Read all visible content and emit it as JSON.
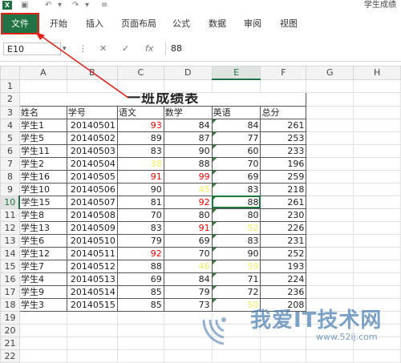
{
  "titlebar": {
    "app_title": "学生成绩",
    "logo": "X",
    "save_icon": "floppy-icon",
    "undo_icon": "↶",
    "redo_icon": "↷"
  },
  "ribbon": {
    "file_tab": "文件",
    "tabs": [
      "开始",
      "插入",
      "页面布局",
      "公式",
      "数据",
      "审阅",
      "视图"
    ]
  },
  "formula_bar": {
    "name_box": "E10",
    "cancel": "✕",
    "enter": "✓",
    "fx": "fx",
    "value": "88"
  },
  "grid": {
    "columns": [
      "A",
      "B",
      "C",
      "D",
      "E",
      "F",
      "G",
      "H"
    ],
    "active_column": "E",
    "active_row": "10",
    "title": "一班成绩表",
    "headers": [
      "姓名",
      "学号",
      "语文",
      "数学",
      "英语",
      "总分"
    ],
    "rows": [
      {
        "n": "4",
        "name": "学生1",
        "id": "20140501",
        "yw": "93",
        "sx": "84",
        "yy": "84",
        "zf": "261"
      },
      {
        "n": "5",
        "name": "学生5",
        "id": "20140502",
        "yw": "89",
        "sx": "87",
        "yy": "77",
        "zf": "253"
      },
      {
        "n": "6",
        "name": "学生11",
        "id": "20140503",
        "yw": "83",
        "sx": "90",
        "yy": "60",
        "zf": "233"
      },
      {
        "n": "7",
        "name": "学生2",
        "id": "20140504",
        "yw": "38",
        "sx": "88",
        "yy": "70",
        "zf": "196"
      },
      {
        "n": "8",
        "name": "学生16",
        "id": "20140505",
        "yw": "91",
        "sx": "99",
        "yy": "69",
        "zf": "259"
      },
      {
        "n": "9",
        "name": "学生10",
        "id": "20140506",
        "yw": "90",
        "sx": "45",
        "yy": "83",
        "zf": "218"
      },
      {
        "n": "10",
        "name": "学生15",
        "id": "20140507",
        "yw": "81",
        "sx": "92",
        "yy": "88",
        "zf": "261"
      },
      {
        "n": "11",
        "name": "学生8",
        "id": "20140508",
        "yw": "70",
        "sx": "80",
        "yy": "80",
        "zf": "230"
      },
      {
        "n": "12",
        "name": "学生13",
        "id": "20140509",
        "yw": "83",
        "sx": "91",
        "yy": "52",
        "zf": "226"
      },
      {
        "n": "13",
        "name": "学生6",
        "id": "20140510",
        "yw": "79",
        "sx": "69",
        "yy": "83",
        "zf": "231"
      },
      {
        "n": "14",
        "name": "学生12",
        "id": "20140511",
        "yw": "92",
        "sx": "70",
        "yy": "90",
        "zf": "252"
      },
      {
        "n": "15",
        "name": "学生7",
        "id": "20140512",
        "yw": "88",
        "sx": "46",
        "yy": "59",
        "zf": "193"
      },
      {
        "n": "16",
        "name": "学生4",
        "id": "20140513",
        "yw": "69",
        "sx": "84",
        "yy": "71",
        "zf": "224"
      },
      {
        "n": "17",
        "name": "学生9",
        "id": "20140514",
        "yw": "85",
        "sx": "79",
        "yy": "72",
        "zf": "236"
      },
      {
        "n": "18",
        "name": "学生3",
        "id": "20140515",
        "yw": "85",
        "sx": "73",
        "yy": "50",
        "zf": "208"
      }
    ],
    "empty_rows": [
      "19",
      "20",
      "21",
      "22"
    ],
    "row_numbers_top": [
      "1",
      "2",
      "3"
    ]
  },
  "watermark": {
    "text": "我爱IT技术网",
    "url": "www.52ij.com"
  },
  "colors": {
    "accent": "#217346",
    "annotation": "#e0221b",
    "high_score": "#ff0000",
    "low_score": "#f2ee60"
  }
}
